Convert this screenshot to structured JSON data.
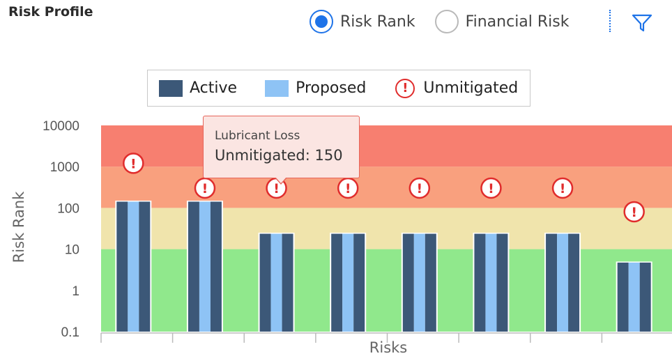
{
  "panel": {
    "title": "Risk Profile",
    "radio_options": [
      {
        "label": "Risk Rank",
        "selected": true
      },
      {
        "label": "Financial Risk",
        "selected": false
      }
    ],
    "filter_icon": "filter-icon"
  },
  "tooltip": {
    "title": "Lubricant Loss",
    "value_text": "Unmitigated: 150"
  },
  "colors": {
    "active": "#3c5878",
    "proposed": "#8ec3f5",
    "unmitigated": "#e02c2c",
    "band_high": "#f77f70",
    "band_mid_high": "#f9a07e",
    "band_medium": "#f0e4ac",
    "band_low": "#90e88c",
    "accent": "#1e73e8"
  },
  "chart_data": {
    "type": "bar",
    "xlabel": "Risks",
    "ylabel": "Risk Rank",
    "yscale": "log",
    "ylim": [
      0.1,
      10000
    ],
    "yticks": [
      "0.1",
      "1",
      "10",
      "100",
      "1000",
      "10000"
    ],
    "legend": {
      "placement": "top-center",
      "entries": [
        "Active",
        "Proposed",
        "Unmitigated"
      ]
    },
    "bands": [
      {
        "from": 0.1,
        "to": 10,
        "color": "#90e88c"
      },
      {
        "from": 10,
        "to": 100,
        "color": "#f0e4ac"
      },
      {
        "from": 100,
        "to": 1000,
        "color": "#f9a07e"
      },
      {
        "from": 1000,
        "to": 10000,
        "color": "#f77f70"
      }
    ],
    "series": [
      {
        "name": "Active",
        "values": [
          150,
          150,
          25,
          25,
          25,
          25,
          25,
          5
        ]
      },
      {
        "name": "Proposed",
        "values": [
          150,
          150,
          25,
          25,
          25,
          25,
          25,
          5
        ]
      },
      {
        "name": "Unmitigated",
        "values": [
          600,
          150,
          150,
          150,
          150,
          150,
          150,
          40
        ]
      }
    ],
    "categories": [
      "",
      "",
      "",
      "",
      "",
      "",
      "",
      ""
    ]
  }
}
